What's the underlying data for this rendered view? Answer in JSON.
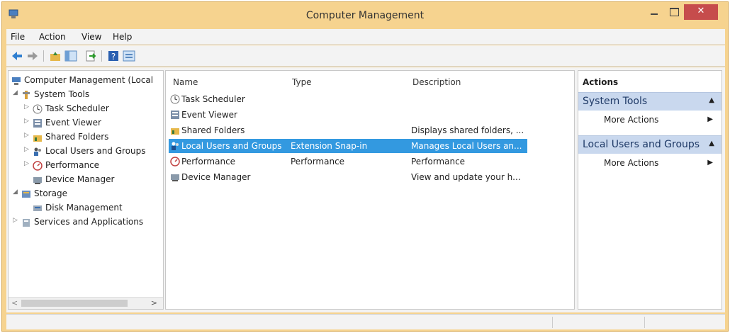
{
  "window": {
    "title": "Computer Management",
    "close_glyph": "✕"
  },
  "menu": [
    "File",
    "Action",
    "View",
    "Help"
  ],
  "toolbar": {
    "icons": [
      "back-arrow-icon",
      "forward-arrow-icon",
      "up-folder-icon",
      "show-tree-icon",
      "export-list-icon",
      "help-icon",
      "properties-icon"
    ]
  },
  "tree": {
    "items": [
      {
        "label": "Computer Management (Local",
        "icon": "computer-management-icon",
        "expander": ""
      },
      {
        "label": "System Tools",
        "icon": "tools-icon",
        "expander": "◢"
      },
      {
        "label": "Task Scheduler",
        "icon": "clock-icon",
        "expander": "▷"
      },
      {
        "label": "Event Viewer",
        "icon": "event-viewer-icon",
        "expander": "▷"
      },
      {
        "label": "Shared Folders",
        "icon": "shared-folder-icon",
        "expander": "▷"
      },
      {
        "label": "Local Users and Groups",
        "icon": "users-icon",
        "expander": "▷"
      },
      {
        "label": "Performance",
        "icon": "performance-icon",
        "expander": "▷"
      },
      {
        "label": "Device Manager",
        "icon": "device-manager-icon",
        "expander": ""
      },
      {
        "label": "Storage",
        "icon": "storage-icon",
        "expander": "◢"
      },
      {
        "label": "Disk Management",
        "icon": "disk-icon",
        "expander": ""
      },
      {
        "label": "Services and Applications",
        "icon": "services-icon",
        "expander": "▷"
      }
    ],
    "scroll_left": "<",
    "scroll_right": ">"
  },
  "list": {
    "columns": {
      "name": "Name",
      "type": "Type",
      "description": "Description"
    },
    "rows": [
      {
        "name": "Task Scheduler",
        "type": "",
        "description": "",
        "icon": "clock-icon"
      },
      {
        "name": "Event Viewer",
        "type": "",
        "description": "",
        "icon": "event-viewer-icon"
      },
      {
        "name": "Shared Folders",
        "type": "",
        "description": "Displays shared folders, ...",
        "icon": "shared-folder-icon"
      },
      {
        "name": "Local Users and Groups",
        "type": "Extension Snap-in",
        "description": "Manages Local Users an...",
        "icon": "users-icon",
        "selected": true
      },
      {
        "name": "Performance",
        "type": "Performance",
        "description": "Performance",
        "icon": "performance-icon"
      },
      {
        "name": "Device Manager",
        "type": "",
        "description": "View and update your h...",
        "icon": "device-manager-icon"
      }
    ]
  },
  "actions": {
    "title": "Actions",
    "groups": [
      {
        "label": "System Tools",
        "item": "More Actions",
        "arrow": "▲",
        "item_arrow": "▶"
      },
      {
        "label": "Local Users and Groups",
        "item": "More Actions",
        "arrow": "▲",
        "item_arrow": "▶"
      }
    ]
  },
  "colors": {
    "titlebar": "#f6d38f",
    "selection": "#3399e0",
    "actions_group": "#c9d8ee",
    "close_button": "#c64c4c"
  }
}
